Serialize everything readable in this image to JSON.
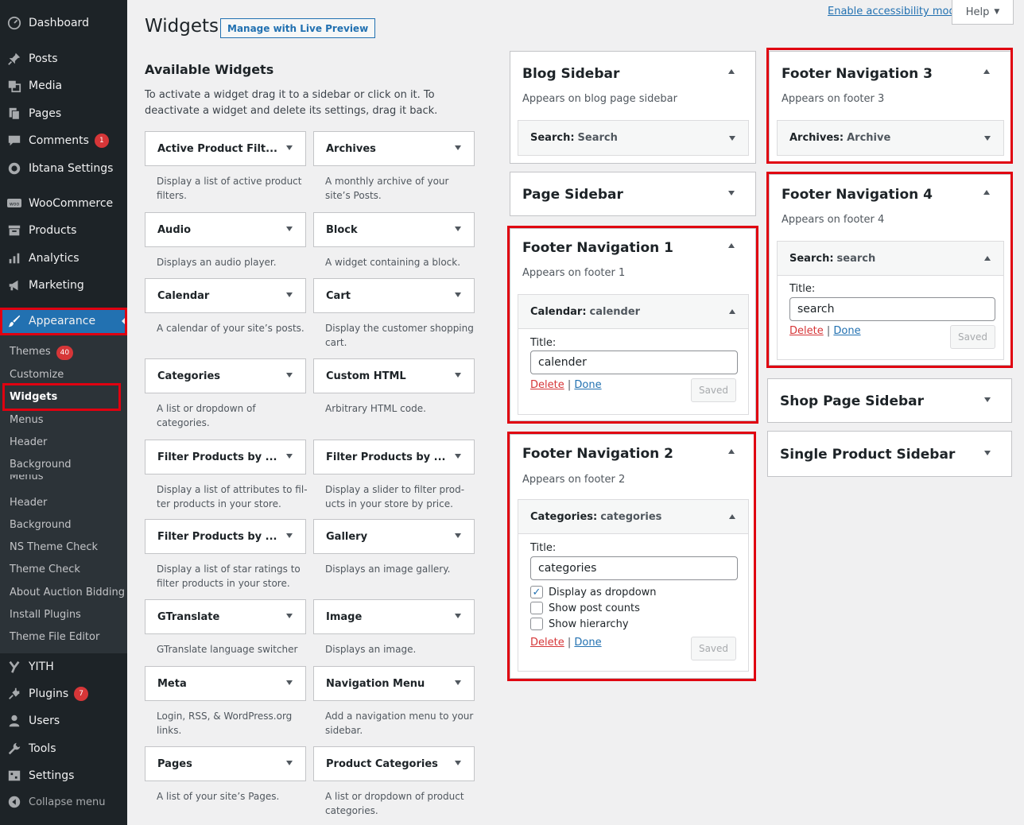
{
  "admin_menu": [
    {
      "label": "Dashboard",
      "icon": "dashboard-icon",
      "badge": ""
    },
    {
      "label": "Posts",
      "icon": "pushpin-icon",
      "badge": ""
    },
    {
      "label": "Media",
      "icon": "media-icon",
      "badge": ""
    },
    {
      "label": "Pages",
      "icon": "pages-icon",
      "badge": ""
    },
    {
      "label": "Comments",
      "icon": "comment-icon",
      "badge": "1"
    },
    {
      "label": "Ibtana Settings",
      "icon": "ibtana-icon",
      "badge": ""
    },
    {
      "label": "WooCommerce",
      "icon": "woocommerce-icon",
      "badge": ""
    },
    {
      "label": "Products",
      "icon": "archive-icon",
      "badge": ""
    },
    {
      "label": "Analytics",
      "icon": "chart-icon",
      "badge": ""
    },
    {
      "label": "Marketing",
      "icon": "megaphone-icon",
      "badge": ""
    },
    {
      "label": "Appearance",
      "icon": "paintbrush-icon",
      "badge": ""
    },
    {
      "label": "YITH",
      "icon": "yith-icon",
      "badge": ""
    },
    {
      "label": "Plugins",
      "icon": "plugin-icon",
      "badge": "7"
    },
    {
      "label": "Users",
      "icon": "user-icon",
      "badge": ""
    },
    {
      "label": "Tools",
      "icon": "wrench-icon",
      "badge": ""
    },
    {
      "label": "Settings",
      "icon": "settings-icon",
      "badge": ""
    },
    {
      "label": "Collapse menu",
      "icon": "collapse-icon",
      "badge": ""
    }
  ],
  "appearance_submenu": [
    {
      "label": "Themes",
      "badge": "40"
    },
    {
      "label": "Customize"
    },
    {
      "label": "Widgets"
    },
    {
      "label": "Menus"
    },
    {
      "label": "Header"
    },
    {
      "label": "Background"
    },
    {
      "label": "Menus"
    },
    {
      "label": "Header"
    },
    {
      "label": "Background"
    },
    {
      "label": "NS Theme Check"
    },
    {
      "label": "Theme Check"
    },
    {
      "label": "About Auction Bidding"
    },
    {
      "label": "Install Plugins"
    },
    {
      "label": "Theme File Editor"
    }
  ],
  "header": {
    "title": "Widgets",
    "live_preview": "Manage with Live Preview",
    "accessibility_link": "Enable accessibility mode",
    "help": "Help"
  },
  "available": {
    "title": "Available Widgets",
    "description": "To activate a widget drag it to a sidebar or click on it. To deactivate a widget and delete its settings, drag it back.",
    "widgets": [
      {
        "name": "Active Product Filt...",
        "desc": "Display a list of active product filters."
      },
      {
        "name": "Archives",
        "desc": "A monthly archive of your site’s Posts."
      },
      {
        "name": "Audio",
        "desc": "Displays an audio player."
      },
      {
        "name": "Block",
        "desc": "A widget containing a block."
      },
      {
        "name": "Calendar",
        "desc": "A calendar of your site’s posts."
      },
      {
        "name": "Cart",
        "desc": "Display the customer shopping cart."
      },
      {
        "name": "Categories",
        "desc": "A list or dropdown of categories."
      },
      {
        "name": "Custom HTML",
        "desc": "Arbitrary HTML code."
      },
      {
        "name": "Filter Products by ...",
        "desc": "Display a list of attributes to fil-ter products in your store."
      },
      {
        "name": "Filter Products by ...",
        "desc": "Display a slider to filter prod-ucts in your store by price."
      },
      {
        "name": "Filter Products by ...",
        "desc": "Display a list of star ratings to filter products in your store."
      },
      {
        "name": "Gallery",
        "desc": "Displays an image gallery."
      },
      {
        "name": "GTranslate",
        "desc": "GTranslate language switcher"
      },
      {
        "name": "Image",
        "desc": "Displays an image."
      },
      {
        "name": "Meta",
        "desc": "Login, RSS, & WordPress.org links."
      },
      {
        "name": "Navigation Menu",
        "desc": "Add a navigation menu to your sidebar."
      },
      {
        "name": "Pages",
        "desc": "A list of your site’s Pages."
      },
      {
        "name": "Product Categories",
        "desc": "A list or dropdown of product categories."
      }
    ]
  },
  "sidebars": {
    "blog": {
      "title": "Blog Sidebar",
      "desc": "Appears on blog page sidebar",
      "widget_type": "Search:",
      "widget_title": "Search"
    },
    "page": {
      "title": "Page Sidebar"
    },
    "footer1": {
      "title": "Footer Navigation 1",
      "desc": "Appears on footer 1",
      "widget_type": "Calendar:",
      "widget_title": "calender",
      "field_label": "Title:",
      "field_value": "calender",
      "delete": "Delete",
      "sep": "|",
      "done": "Done",
      "saved": "Saved"
    },
    "footer2": {
      "title": "Footer Navigation 2",
      "desc": "Appears on footer 2",
      "widget_type": "Categories:",
      "widget_title": "categories",
      "field_label": "Title:",
      "field_value": "categories",
      "opt1": "Display as dropdown",
      "opt2": "Show post counts",
      "opt3": "Show hierarchy",
      "delete": "Delete",
      "sep": "|",
      "done": "Done",
      "saved": "Saved"
    },
    "footer3": {
      "title": "Footer Navigation 3",
      "desc": "Appears on footer 3",
      "widget_type": "Archives:",
      "widget_title": "Archive"
    },
    "footer4": {
      "title": "Footer Navigation 4",
      "desc": "Appears on footer 4",
      "widget_type": "Search:",
      "widget_title": "search",
      "field_label": "Title:",
      "field_value": "search",
      "delete": "Delete",
      "sep": "|",
      "done": "Done",
      "saved": "Saved"
    },
    "shop": {
      "title": "Shop Page Sidebar"
    },
    "single": {
      "title": "Single Product Sidebar"
    }
  },
  "colors": {
    "admin_bg": "#1d2327",
    "submenu_bg": "#2c3338",
    "accent": "#2271b1",
    "highlight": "#e00010",
    "badge": "#d63638"
  }
}
